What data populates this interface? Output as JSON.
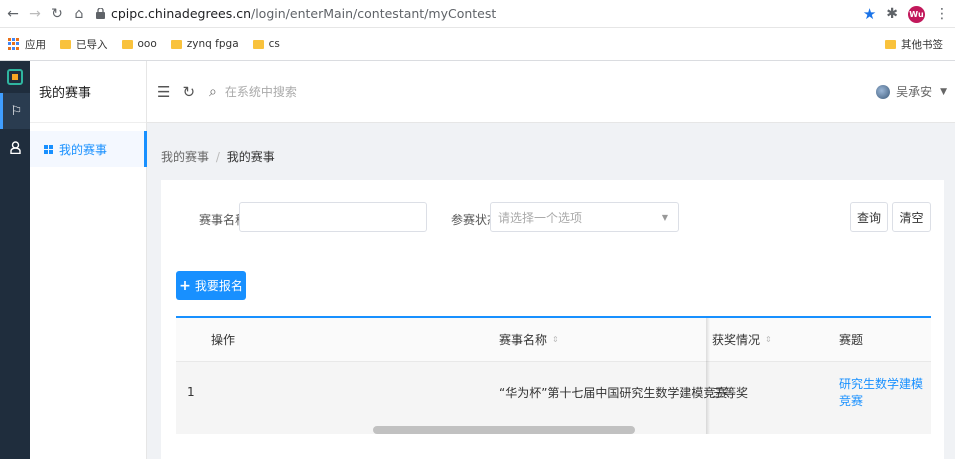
{
  "browser": {
    "url_host": "cpipc.chinadegrees.cn",
    "url_path": "/login/enterMain/contestant/myContest",
    "profile_initials": "Wu"
  },
  "bookmarks": {
    "items": [
      "应用",
      "已导入",
      "ooo",
      "zynq fpga",
      "cs"
    ],
    "other": "其他书签"
  },
  "sidebar": {
    "title": "我的赛事",
    "menu_item": "我的赛事"
  },
  "topbar": {
    "search_placeholder": "在系统中搜索",
    "username": "吴承安"
  },
  "breadcrumb": {
    "parent": "我的赛事",
    "separator": "/",
    "current": "我的赛事"
  },
  "filters": {
    "name_label": "赛事名称",
    "name_value": "",
    "status_label": "参赛状态",
    "status_placeholder": "请选择一个选项",
    "query_label": "查询",
    "clear_label": "清空"
  },
  "register_button": "我要报名",
  "table": {
    "columns": [
      "操作",
      "赛事名称",
      "获奖情况",
      "赛题"
    ],
    "rows": [
      {
        "index": "1",
        "contest": "“华为杯”第十七届中国研究生数学建模竞赛",
        "award": "三等奖",
        "topic": "研究生数学建模竞赛"
      }
    ]
  }
}
